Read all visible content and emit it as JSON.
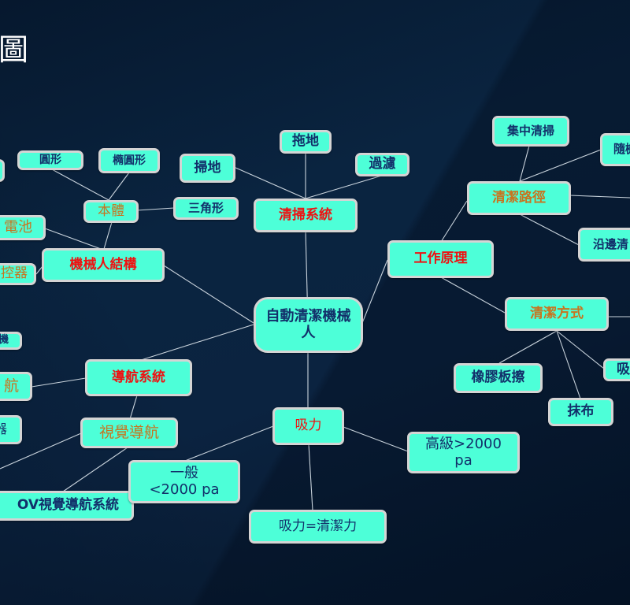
{
  "title": "圖",
  "colors": {
    "background": "#0a2440",
    "node_fill": "#4dffd8",
    "node_border": "#d4d4d4",
    "text_primary": "#12306a",
    "text_level1": "#ee1111",
    "text_level2": "#c8741f",
    "link": "#c9d3dc"
  },
  "mindmap": {
    "center": "自動清潔機械人",
    "branches": {
      "cleaning_system": {
        "label": "清掃系統",
        "children": [
          "掃地",
          "拖地",
          "過濾"
        ]
      },
      "working_principle": {
        "label": "工作原理",
        "cleaning_path": {
          "label": "清潔路徑",
          "children": [
            "集中清掃",
            "隨機",
            "沿邊清"
          ]
        },
        "cleaning_method": {
          "label": "清潔方式",
          "children": [
            "橡膠板擦",
            "抹布",
            "吸"
          ]
        }
      },
      "robot_structure": {
        "label": "機械人結構",
        "body": {
          "label": "本體",
          "children": [
            "圓形",
            "橢圓形",
            "三角形"
          ]
        },
        "battery": "電池",
        "controller": "控器"
      },
      "navigation_system": {
        "label": "導航系統",
        "partial_children": [
          "機",
          "航",
          "器"
        ],
        "visual_navigation": {
          "label": "視覺導航",
          "children": [
            "OV視覺導航系統"
          ]
        }
      },
      "suction": {
        "label": "吸力",
        "children": [
          "一般<2000 pa",
          "高級>2000 pa",
          "吸力=清潔力"
        ]
      }
    }
  },
  "nodes": {
    "center": "自動清潔機械人",
    "cleaning_system": "清掃系統",
    "sweep": "掃地",
    "mop": "拖地",
    "filter": "過濾",
    "working_principle": "工作原理",
    "cleaning_path": "清潔路徑",
    "focused_cleaning": "集中清掃",
    "random": "隨機",
    "edge_cleaning": "沿邊清",
    "cleaning_method": "清潔方式",
    "rubber_wiper": "橡膠板擦",
    "cloth": "抹布",
    "suck": "吸",
    "robot_structure": "機械人結構",
    "body": "本體",
    "round": "圓形",
    "oval": "橢圓形",
    "triangle": "三角形",
    "battery": "電池",
    "controller": "控器",
    "navigation_system": "導航系統",
    "nav_child_machine": "機",
    "nav_child_nav": "航",
    "nav_child_device": "器",
    "visual_navigation": "視覺導航",
    "ov_visual_nav": "OV視覺導航系統",
    "suction": "吸力",
    "normal_suction": "一般<2000 pa",
    "high_suction": "高級>2000 pa",
    "suction_equals": "吸力=清潔力"
  }
}
